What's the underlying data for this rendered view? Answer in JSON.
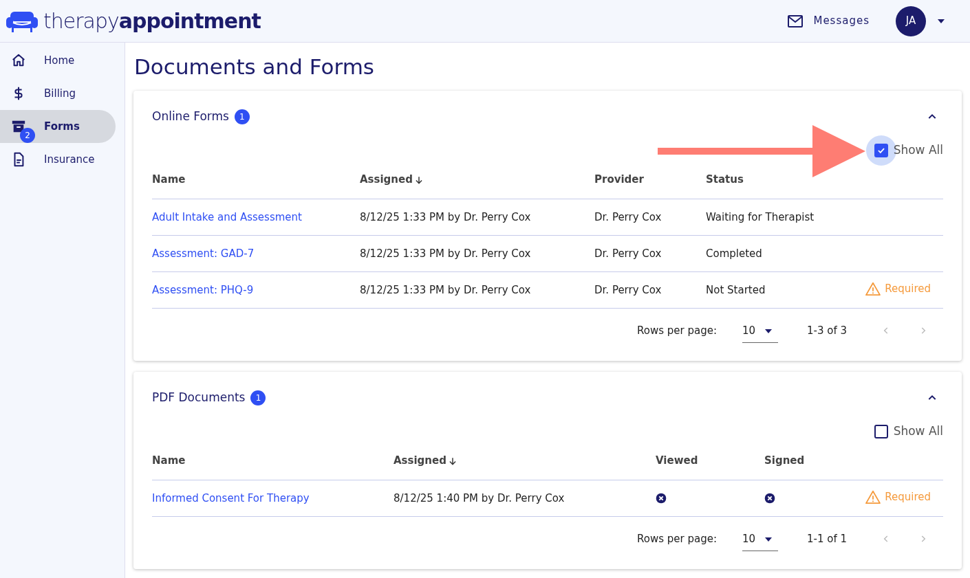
{
  "header": {
    "logo_light": "therapy",
    "logo_bold": "appointment",
    "messages": "Messages",
    "avatar": "JA"
  },
  "sidebar": {
    "items": [
      {
        "label": "Home",
        "selected": false
      },
      {
        "label": "Billing",
        "selected": false
      },
      {
        "label": "Forms",
        "selected": true,
        "badge": "2"
      },
      {
        "label": "Insurance",
        "selected": false
      }
    ]
  },
  "page_title": "Documents and Forms",
  "sections": [
    {
      "title": "Online Forms",
      "badge": "1",
      "expanded": true,
      "show_all": {
        "label": "Show All",
        "checked": true,
        "annotated": true
      },
      "columns": [
        {
          "label": "Name",
          "sorted": false
        },
        {
          "label": "Assigned",
          "sorted": true
        },
        {
          "label": "Provider",
          "sorted": false
        },
        {
          "label": "Status",
          "sorted": false
        }
      ],
      "rows": [
        {
          "cells": [
            {
              "kind": "link",
              "text": "Adult Intake and Assessment"
            },
            {
              "kind": "text",
              "text": "8/12/25 1:33 PM by Dr. Perry Cox"
            },
            {
              "kind": "text",
              "text": "Dr. Perry Cox"
            },
            {
              "kind": "text",
              "text": "Waiting for Therapist"
            }
          ]
        },
        {
          "cells": [
            {
              "kind": "link",
              "text": "Assessment: GAD-7"
            },
            {
              "kind": "text",
              "text": "8/12/25 1:33 PM by Dr. Perry Cox"
            },
            {
              "kind": "text",
              "text": "Dr. Perry Cox"
            },
            {
              "kind": "text",
              "text": "Completed"
            }
          ]
        },
        {
          "cells": [
            {
              "kind": "link",
              "text": "Assessment: PHQ-9"
            },
            {
              "kind": "text",
              "text": "8/12/25 1:33 PM by Dr. Perry Cox"
            },
            {
              "kind": "text",
              "text": "Dr. Perry Cox"
            },
            {
              "kind": "text",
              "text": "Not Started"
            }
          ],
          "required": "Required"
        }
      ],
      "pagination": {
        "label": "Rows per page:",
        "per_page": "10",
        "range": "1-3 of 3"
      }
    },
    {
      "title": "PDF Documents",
      "badge": "1",
      "expanded": true,
      "show_all": {
        "label": "Show All",
        "checked": false
      },
      "columns": [
        {
          "label": "Name",
          "sorted": false
        },
        {
          "label": "Assigned",
          "sorted": true
        },
        {
          "label": "Viewed",
          "sorted": false
        },
        {
          "label": "Signed",
          "sorted": false
        }
      ],
      "rows": [
        {
          "cells": [
            {
              "kind": "link",
              "text": "Informed Consent For Therapy"
            },
            {
              "kind": "text",
              "text": "8/12/25 1:40 PM by Dr. Perry Cox"
            },
            {
              "kind": "flag",
              "checked": false
            },
            {
              "kind": "flag",
              "checked": false
            }
          ],
          "required": "Required"
        }
      ],
      "pagination": {
        "label": "Rows per page:",
        "per_page": "10",
        "range": "1-1 of 1"
      }
    }
  ]
}
